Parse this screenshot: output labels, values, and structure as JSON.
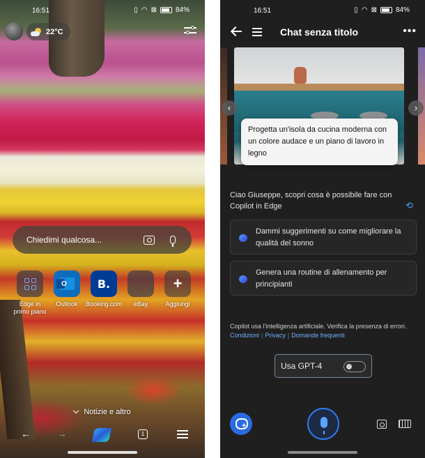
{
  "left": {
    "status": {
      "time": "16:51",
      "battery": "84%"
    },
    "weather": {
      "temperature": "22°C",
      "icon": "partly-cloudy-icon"
    },
    "search": {
      "placeholder": "Chiedimi qualcosa..."
    },
    "shortcuts": [
      {
        "label": "Edge in primo piano",
        "icon": "edge-grid-icon"
      },
      {
        "label": "Outlook",
        "glyph": "O",
        "icon": "outlook-icon"
      },
      {
        "label": "Booking.com",
        "glyph": "B.",
        "icon": "booking-icon"
      },
      {
        "label": "eBay",
        "icon": "ebay-icon"
      },
      {
        "label": "Aggiungi",
        "glyph": "+",
        "icon": "plus-icon"
      }
    ],
    "news_label": "Notizie e altro",
    "tab_count": "1"
  },
  "right": {
    "status": {
      "time": "16:51",
      "battery": "84%"
    },
    "header": {
      "title": "Chat senza titolo",
      "more": "•••"
    },
    "carousel": {
      "caption": "Progetta un'isola da cucina moderna con un colore audace e un piano di lavoro in legno",
      "prev": "‹",
      "next": "›"
    },
    "greeting": "Ciao Giuseppe, scopri cosa è possibile fare con Copilot in Edge",
    "suggestions": [
      "Dammi suggerimenti su come migliorare la qualità del sonno",
      "Genera una routine di allenamento per principianti"
    ],
    "disclaimer": {
      "text": "Copilot usa l'intelligenza artificiale. Verifica la presenza di errori.",
      "links": [
        "Condizioni",
        "Privacy",
        "Domande frequenti"
      ]
    },
    "gpt4": {
      "label": "Usa GPT-4",
      "enabled": false
    }
  },
  "colors": {
    "accent": "#2f7bf0",
    "dark_bg": "#1f1f1f"
  }
}
